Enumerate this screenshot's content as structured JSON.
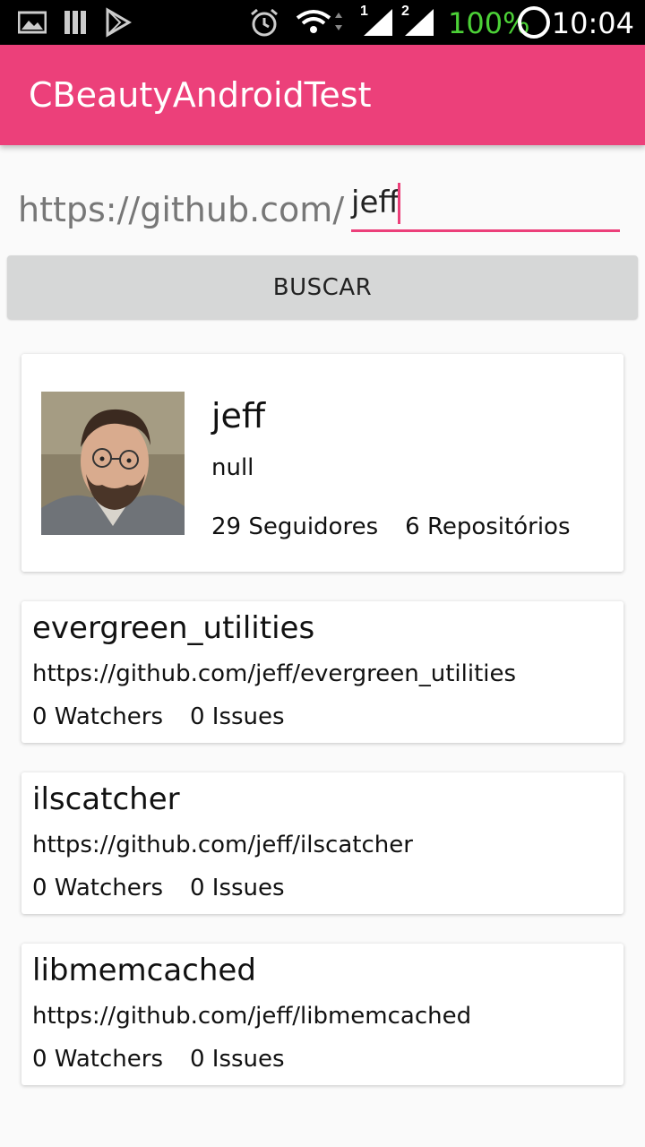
{
  "status_bar": {
    "battery": "100%",
    "time": "10:04",
    "signal_1": "1",
    "signal_2": "2"
  },
  "app": {
    "title": "CBeautyAndroidTest"
  },
  "search": {
    "prefix": "https://github.com/",
    "value": "jeff",
    "button_label": "BUSCAR"
  },
  "user": {
    "name": "jeff",
    "bio": "null",
    "followers": "29 Seguidores",
    "repos": "6 Repositórios"
  },
  "repos": [
    {
      "name": "evergreen_utilities",
      "url": "https://github.com/jeff/evergreen_utilities",
      "watchers": "0 Watchers",
      "issues": "0 Issues"
    },
    {
      "name": "ilscatcher",
      "url": "https://github.com/jeff/ilscatcher",
      "watchers": "0 Watchers",
      "issues": "0 Issues"
    },
    {
      "name": "libmemcached",
      "url": "https://github.com/jeff/libmemcached",
      "watchers": "0 Watchers",
      "issues": "0 Issues"
    }
  ],
  "colors": {
    "accent": "#ec407a",
    "status_green": "#4cd137",
    "button_bg": "#d6d7d7"
  }
}
